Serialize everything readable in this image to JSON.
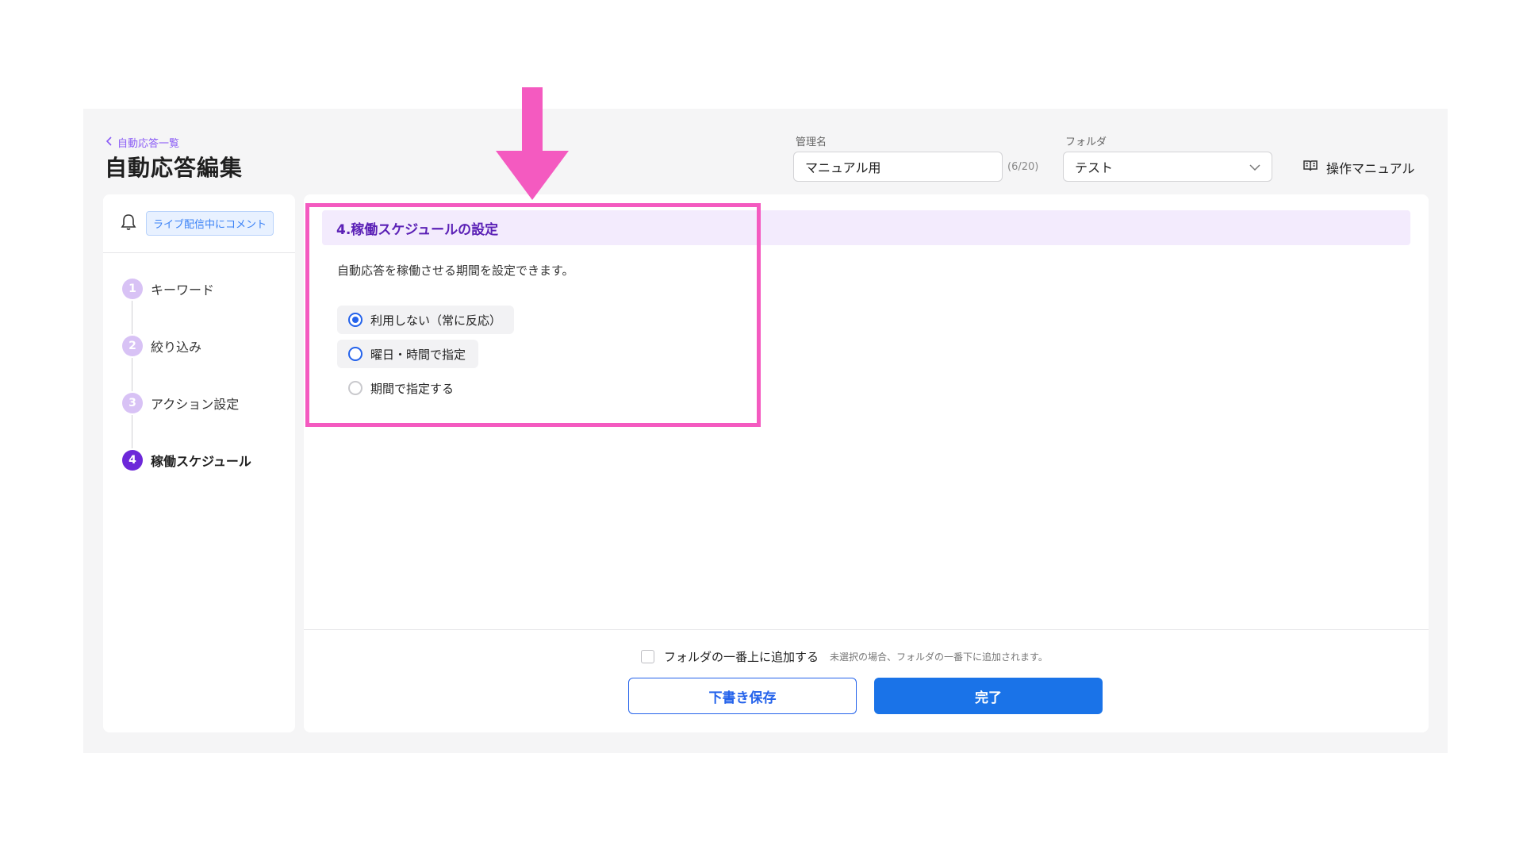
{
  "header": {
    "back_label": "自動応答一覧",
    "title": "自動応答編集",
    "name_field": {
      "label": "管理名",
      "value": "マニュアル用",
      "counter": "(6/20)"
    },
    "folder_field": {
      "label": "フォルダ",
      "value": "テスト"
    },
    "manual_link": "操作マニュアル"
  },
  "sidebar": {
    "badge": "ライブ配信中にコメント",
    "steps": [
      {
        "num": "1",
        "label": "キーワード"
      },
      {
        "num": "2",
        "label": "絞り込み"
      },
      {
        "num": "3",
        "label": "アクション設定"
      },
      {
        "num": "4",
        "label": "稼働スケジュール",
        "active": true
      }
    ]
  },
  "section": {
    "title": "4.稼働スケジュールの設定",
    "description": "自動応答を稼働させる期間を設定できます。",
    "options": [
      {
        "label": "利用しない（常に反応）",
        "selected": true
      },
      {
        "label": "曜日・時間で指定",
        "selected": false
      },
      {
        "label": "期間で指定する",
        "selected": false
      }
    ]
  },
  "footer": {
    "checkbox_label": "フォルダの一番上に追加する",
    "checkbox_hint": "未選択の場合、フォルダの一番下に追加されます。",
    "draft_button": "下書き保存",
    "done_button": "完了"
  },
  "colors": {
    "accent_purple": "#6d28d9",
    "primary_blue": "#1a73e8",
    "highlight_pink": "#f45ac0"
  },
  "icons": [
    "chevron-left-icon",
    "chevron-down-icon",
    "book-icon",
    "bell-icon"
  ]
}
